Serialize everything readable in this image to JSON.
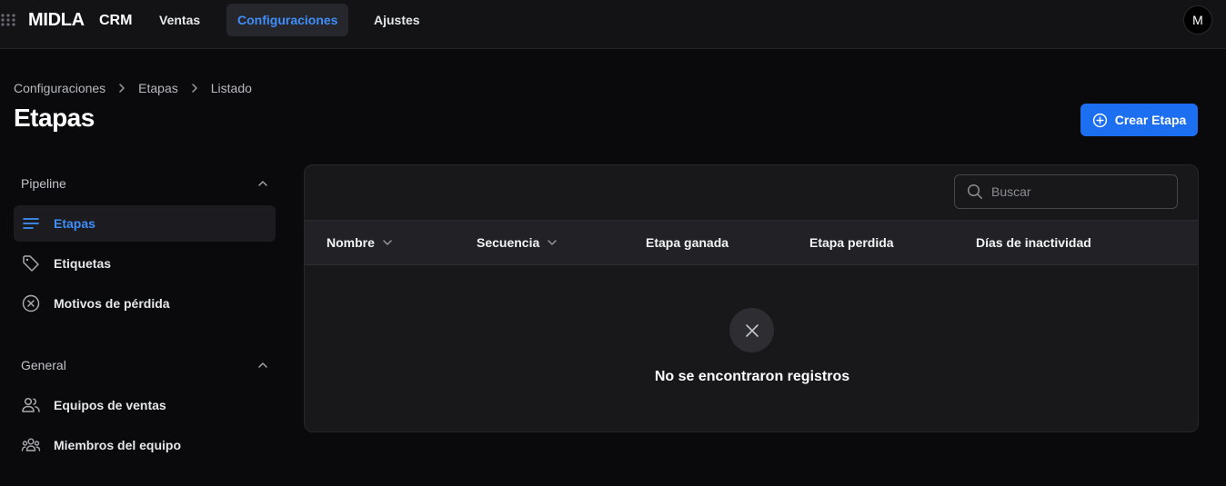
{
  "topbar": {
    "brand": "MIDLA",
    "app_name": "CRM",
    "nav": [
      {
        "label": "Ventas",
        "active": false
      },
      {
        "label": "Configuraciones",
        "active": true
      },
      {
        "label": "Ajustes",
        "active": false
      }
    ],
    "avatar_initial": "M"
  },
  "header": {
    "breadcrumb": [
      "Configuraciones",
      "Etapas",
      "Listado"
    ],
    "title": "Etapas",
    "create_button": "Crear Etapa"
  },
  "sidebar": {
    "sections": [
      {
        "title": "Pipeline",
        "expanded": true,
        "items": [
          {
            "label": "Etapas",
            "icon": "list-lines-icon",
            "active": true
          },
          {
            "label": "Etiquetas",
            "icon": "tag-icon",
            "active": false
          },
          {
            "label": "Motivos de pérdida",
            "icon": "x-circle-icon",
            "active": false
          }
        ]
      },
      {
        "title": "General",
        "expanded": true,
        "items": [
          {
            "label": "Equipos de ventas",
            "icon": "users-icon",
            "active": false
          },
          {
            "label": "Miembros del equipo",
            "icon": "team-icon",
            "active": false
          }
        ]
      }
    ]
  },
  "table": {
    "search_placeholder": "Buscar",
    "columns": [
      {
        "label": "Nombre",
        "sortable": true
      },
      {
        "label": "Secuencia",
        "sortable": true
      },
      {
        "label": "Etapa ganada",
        "sortable": false
      },
      {
        "label": "Etapa perdida",
        "sortable": false
      },
      {
        "label": "Días de inactividad",
        "sortable": false
      }
    ],
    "rows": [],
    "empty_message": "No se encontraron registros"
  },
  "colors": {
    "accent": "#3f8ef8",
    "primary_button": "#1d6ff2",
    "background": "#0a0a0c",
    "panel": "#18181b"
  }
}
